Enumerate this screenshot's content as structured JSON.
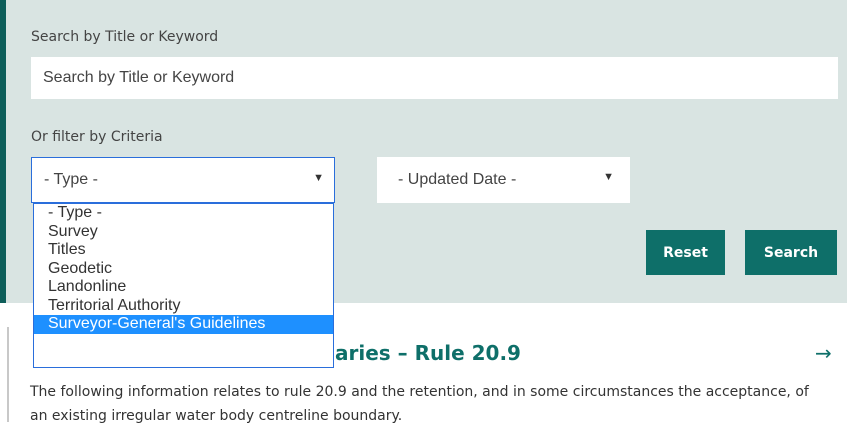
{
  "search": {
    "label": "Search by Title or Keyword",
    "placeholder": "Search by Title or Keyword"
  },
  "filter": {
    "label": "Or filter by Criteria",
    "type_select": {
      "selected": "- Type -",
      "options": [
        "- Type -",
        "Survey",
        "Titles",
        "Geodetic",
        "Landonline",
        "Territorial Authority",
        "Surveyor-General's Guidelines"
      ],
      "highlighted": "Surveyor-General's Guidelines"
    },
    "date_select": {
      "selected": "- Updated Date -"
    }
  },
  "buttons": {
    "reset": "Reset",
    "search": "Search"
  },
  "article": {
    "title_partial": "aries – Rule 20.9",
    "description": "The following information relates to rule 20.9 and the retention, and in some circumstances the acceptance, of an existing irregular water body centreline boundary."
  },
  "icons": {
    "select_arrow": "dropdown-arrow-icon",
    "article_link": "arrow-right-icon"
  },
  "colors": {
    "panel_bg": "#d9e4e2",
    "accent": "#0e5e5a",
    "button_bg": "#0e6f69",
    "highlight": "#1e90ff",
    "focus_border": "#2a6edb"
  }
}
